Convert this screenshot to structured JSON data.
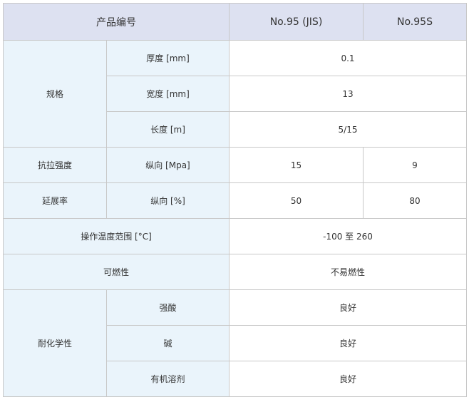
{
  "header": {
    "product_code": "产品编号",
    "model_a": "No.95 (JIS)",
    "model_b": "No.95S"
  },
  "spec": {
    "group": "规格",
    "thickness_label": "厚度 [mm]",
    "thickness_value": "0.1",
    "width_label": "宽度 [mm]",
    "width_value": "13",
    "length_label": "长度 [m]",
    "length_value": "5/15"
  },
  "tensile": {
    "group": "抗拉强度",
    "label": "纵向 [Mpa]",
    "value_a": "15",
    "value_b": "9"
  },
  "elongation": {
    "group": "延展率",
    "label": "纵向 [%]",
    "value_a": "50",
    "value_b": "80"
  },
  "temperature": {
    "label": "操作温度范围 [°C]",
    "value": "-100 至 260"
  },
  "flammability": {
    "label": "可燃性",
    "value": "不易燃性"
  },
  "chemical": {
    "group": "耐化学性",
    "acid_label": "强酸",
    "acid_value": "良好",
    "alkali_label": "碱",
    "alkali_value": "良好",
    "solvent_label": "有机溶剂",
    "solvent_value": "良好"
  }
}
